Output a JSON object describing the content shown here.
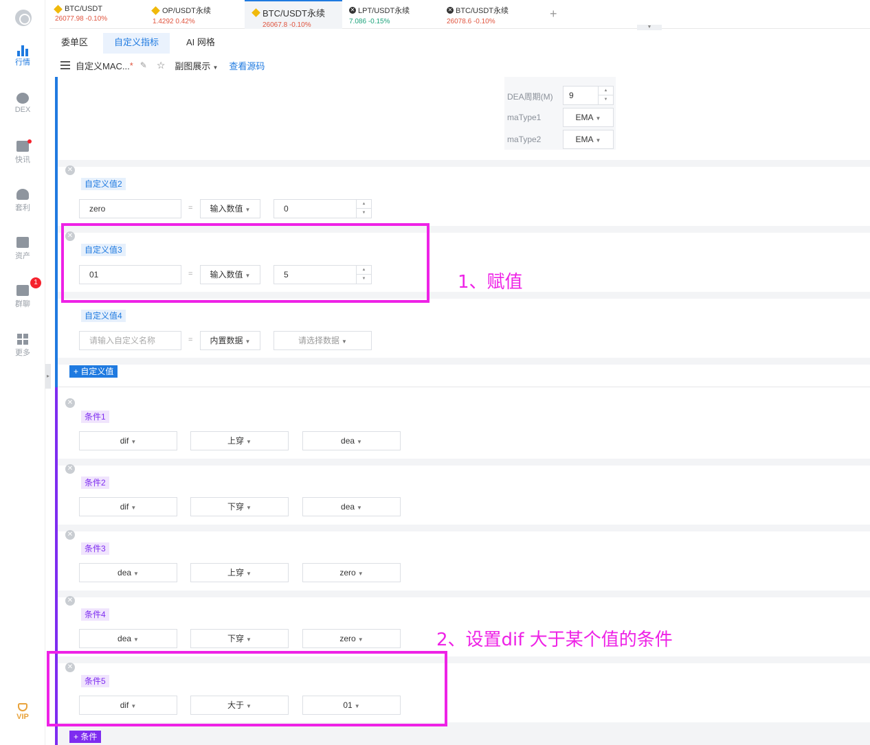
{
  "tabs": [
    {
      "name": "BTC/USDT",
      "price": "26077.98",
      "change": "-0.10%",
      "icon": "bnb-icon"
    },
    {
      "name": "OP/USDT永续",
      "price": "1.4292",
      "change": "0.42%",
      "icon": "bnb-icon"
    },
    {
      "name": "BTC/USDT永续",
      "price": "26067.8",
      "change": "-0.10%",
      "icon": "bnb-icon"
    },
    {
      "name": "LPT/USDT永续",
      "price": "7.086",
      "change": "-0.15%",
      "icon": "okx-icon"
    },
    {
      "name": "BTC/USDT永续",
      "price": "26078.6",
      "change": "-0.10%",
      "icon": "okx-icon"
    }
  ],
  "sidebar": {
    "items": [
      {
        "label": "行情"
      },
      {
        "label": "DEX"
      },
      {
        "label": "快讯"
      },
      {
        "label": "套利"
      },
      {
        "label": "资产"
      },
      {
        "label": "群聊",
        "badge": "1"
      },
      {
        "label": "更多"
      }
    ],
    "vip_label": "VIP"
  },
  "subtabs": [
    "委单区",
    "自定义指标",
    "AI 网格"
  ],
  "toolbar": {
    "indicator_name": "自定义MAC...",
    "modified_mark": "*",
    "subchart_label": "副图展示",
    "view_source_label": "查看源码"
  },
  "params": [
    {
      "label": "DEA周期(M)",
      "value": "9",
      "kind": "number"
    },
    {
      "label": "maType1",
      "value": "EMA",
      "kind": "select"
    },
    {
      "label": "maType2",
      "value": "EMA",
      "kind": "select"
    }
  ],
  "custom_values": [
    {
      "tag": "自定义值2",
      "name": "zero",
      "type": "输入数值",
      "value": "0"
    },
    {
      "tag": "自定义值3",
      "name": "01",
      "type": "输入数值",
      "value": "5"
    },
    {
      "tag": "自定义值4",
      "name_placeholder": "请输入自定义名称",
      "type": "内置数据",
      "value_placeholder": "请选择数据"
    }
  ],
  "add_custom_value_label": "+ 自定义值",
  "conditions": [
    {
      "tag": "条件1",
      "left": "dif",
      "op": "上穿",
      "right": "dea"
    },
    {
      "tag": "条件2",
      "left": "dif",
      "op": "下穿",
      "right": "dea"
    },
    {
      "tag": "条件3",
      "left": "dea",
      "op": "上穿",
      "right": "zero"
    },
    {
      "tag": "条件4",
      "left": "dea",
      "op": "下穿",
      "right": "zero"
    },
    {
      "tag": "条件5",
      "left": "dif",
      "op": "大于",
      "right": "01"
    }
  ],
  "add_condition_label": "+ 条件",
  "equals_sign": "=",
  "annotations": {
    "note1": "1、赋值",
    "note2": "2、设置dif 大于某个值的条件"
  },
  "colors": {
    "accent_blue": "#1f7ae0",
    "accent_purple": "#7e2cf0",
    "annotation_magenta": "#ee22e6",
    "price_down": "#e0533d",
    "price_up": "#1ba27a"
  }
}
